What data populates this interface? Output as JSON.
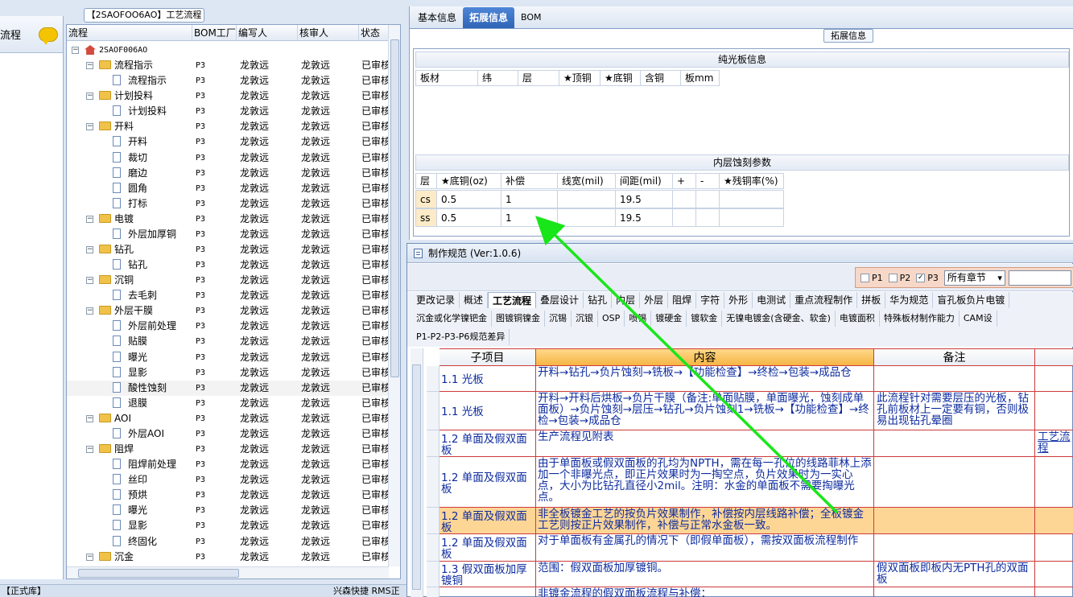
{
  "left_strip": {
    "label": "流程"
  },
  "tree": {
    "title": "【2SAOFOO6AO】工艺流程",
    "columns": [
      "流程",
      "BOM工厂",
      "编写人",
      "核审人",
      "状态"
    ],
    "rows": [
      {
        "level": 0,
        "type": "root",
        "name": "2SAOF006AO",
        "bom": "",
        "writer": "",
        "reviewer": "",
        "status": ""
      },
      {
        "level": 1,
        "type": "folder",
        "name": "流程指示",
        "bom": "P3",
        "writer": "龙敦远",
        "reviewer": "龙敦远",
        "status": "已审核"
      },
      {
        "level": 2,
        "type": "doc",
        "name": "流程指示",
        "bom": "P3",
        "writer": "龙敦远",
        "reviewer": "龙敦远",
        "status": "已审核"
      },
      {
        "level": 1,
        "type": "folder",
        "name": "计划投料",
        "bom": "P3",
        "writer": "龙敦远",
        "reviewer": "龙敦远",
        "status": "已审核"
      },
      {
        "level": 2,
        "type": "doc",
        "name": "计划投料",
        "bom": "P3",
        "writer": "龙敦远",
        "reviewer": "龙敦远",
        "status": "已审核"
      },
      {
        "level": 1,
        "type": "folder",
        "name": "开料",
        "bom": "P3",
        "writer": "龙敦远",
        "reviewer": "龙敦远",
        "status": "已审核"
      },
      {
        "level": 2,
        "type": "doc",
        "name": "开料",
        "bom": "P3",
        "writer": "龙敦远",
        "reviewer": "龙敦远",
        "status": "已审核"
      },
      {
        "level": 2,
        "type": "doc",
        "name": "裁切",
        "bom": "P3",
        "writer": "龙敦远",
        "reviewer": "龙敦远",
        "status": "已审核"
      },
      {
        "level": 2,
        "type": "doc",
        "name": "磨边",
        "bom": "P3",
        "writer": "龙敦远",
        "reviewer": "龙敦远",
        "status": "已审核"
      },
      {
        "level": 2,
        "type": "doc",
        "name": "圆角",
        "bom": "P3",
        "writer": "龙敦远",
        "reviewer": "龙敦远",
        "status": "已审核"
      },
      {
        "level": 2,
        "type": "doc",
        "name": "打标",
        "bom": "P3",
        "writer": "龙敦远",
        "reviewer": "龙敦远",
        "status": "已审核"
      },
      {
        "level": 1,
        "type": "folder",
        "name": "电镀",
        "bom": "P3",
        "writer": "龙敦远",
        "reviewer": "龙敦远",
        "status": "已审核"
      },
      {
        "level": 2,
        "type": "doc",
        "name": "外层加厚铜",
        "bom": "P3",
        "writer": "龙敦远",
        "reviewer": "龙敦远",
        "status": "已审核"
      },
      {
        "level": 1,
        "type": "folder",
        "name": "钻孔",
        "bom": "P3",
        "writer": "龙敦远",
        "reviewer": "龙敦远",
        "status": "已审核"
      },
      {
        "level": 2,
        "type": "doc",
        "name": "钻孔",
        "bom": "P3",
        "writer": "龙敦远",
        "reviewer": "龙敦远",
        "status": "已审核"
      },
      {
        "level": 1,
        "type": "folder",
        "name": "沉铜",
        "bom": "P3",
        "writer": "龙敦远",
        "reviewer": "龙敦远",
        "status": "已审核"
      },
      {
        "level": 2,
        "type": "doc",
        "name": "去毛刺",
        "bom": "P3",
        "writer": "龙敦远",
        "reviewer": "龙敦远",
        "status": "已审核"
      },
      {
        "level": 1,
        "type": "folder",
        "name": "外层干膜",
        "bom": "P3",
        "writer": "龙敦远",
        "reviewer": "龙敦远",
        "status": "已审核"
      },
      {
        "level": 2,
        "type": "doc",
        "name": "外层前处理",
        "bom": "P3",
        "writer": "龙敦远",
        "reviewer": "龙敦远",
        "status": "已审核"
      },
      {
        "level": 2,
        "type": "doc",
        "name": "贴膜",
        "bom": "P3",
        "writer": "龙敦远",
        "reviewer": "龙敦远",
        "status": "已审核"
      },
      {
        "level": 2,
        "type": "doc",
        "name": "曝光",
        "bom": "P3",
        "writer": "龙敦远",
        "reviewer": "龙敦远",
        "status": "已审核"
      },
      {
        "level": 2,
        "type": "doc",
        "name": "显影",
        "bom": "P3",
        "writer": "龙敦远",
        "reviewer": "龙敦远",
        "status": "已审核"
      },
      {
        "level": 2,
        "type": "doc",
        "name": "酸性蚀刻",
        "bom": "P3",
        "writer": "龙敦远",
        "reviewer": "龙敦远",
        "status": "已审核",
        "selected": true
      },
      {
        "level": 2,
        "type": "doc",
        "name": "退膜",
        "bom": "P3",
        "writer": "龙敦远",
        "reviewer": "龙敦远",
        "status": "已审核"
      },
      {
        "level": 1,
        "type": "folder",
        "name": "AOI",
        "bom": "P3",
        "writer": "龙敦远",
        "reviewer": "龙敦远",
        "status": "已审核"
      },
      {
        "level": 2,
        "type": "doc",
        "name": "外层AOI",
        "bom": "P3",
        "writer": "龙敦远",
        "reviewer": "龙敦远",
        "status": "已审核"
      },
      {
        "level": 1,
        "type": "folder",
        "name": "阻焊",
        "bom": "P3",
        "writer": "龙敦远",
        "reviewer": "龙敦远",
        "status": "已审核"
      },
      {
        "level": 2,
        "type": "doc",
        "name": "阻焊前处理",
        "bom": "P3",
        "writer": "龙敦远",
        "reviewer": "龙敦远",
        "status": "已审核"
      },
      {
        "level": 2,
        "type": "doc",
        "name": "丝印",
        "bom": "P3",
        "writer": "龙敦远",
        "reviewer": "龙敦远",
        "status": "已审核"
      },
      {
        "level": 2,
        "type": "doc",
        "name": "预烘",
        "bom": "P3",
        "writer": "龙敦远",
        "reviewer": "龙敦远",
        "status": "已审核"
      },
      {
        "level": 2,
        "type": "doc",
        "name": "曝光",
        "bom": "P3",
        "writer": "龙敦远",
        "reviewer": "龙敦远",
        "status": "已审核"
      },
      {
        "level": 2,
        "type": "doc",
        "name": "显影",
        "bom": "P3",
        "writer": "龙敦远",
        "reviewer": "龙敦远",
        "status": "已审核"
      },
      {
        "level": 2,
        "type": "doc",
        "name": "终固化",
        "bom": "P3",
        "writer": "龙敦远",
        "reviewer": "龙敦远",
        "status": "已审核"
      },
      {
        "level": 1,
        "type": "folder",
        "name": "沉金",
        "bom": "P3",
        "writer": "龙敦远",
        "reviewer": "龙敦远",
        "status": "已审核"
      }
    ]
  },
  "status_bar": {
    "left": "【正式库】",
    "right": "兴森快捷 RMS正"
  },
  "right_tabs": {
    "items": [
      "基本信息",
      "拓展信息",
      "BOM"
    ],
    "active": 1
  },
  "ext": {
    "legend": "拓展信息",
    "section1_title": "纯光板信息",
    "section1_cols": [
      "板材",
      "纬",
      "层",
      "★顶铜",
      "★底铜",
      "含铜",
      "板mm"
    ],
    "section2_title": "内层蚀刻参数",
    "section2_cols": [
      "层",
      "★底铜(oz)",
      "补偿",
      "线宽(mil)",
      "间距(mil)",
      "+",
      "-",
      "★残铜率(%)"
    ],
    "section2_rows": [
      [
        "cs",
        "0.5",
        "1",
        "",
        "19.5",
        "",
        "",
        ""
      ],
      [
        "ss",
        "0.5",
        "1",
        "",
        "19.5",
        "",
        "",
        ""
      ]
    ]
  },
  "popup": {
    "title": "制作规范 (Ver:1.0.6)",
    "filters": [
      {
        "label": "P1",
        "checked": false
      },
      {
        "label": "P2",
        "checked": false
      },
      {
        "label": "P3",
        "checked": true
      }
    ],
    "chapter_select": "所有章节",
    "tabs_row1": [
      "更改记录",
      "概述",
      "工艺流程",
      "叠层设计",
      "钻孔",
      "内层",
      "外层",
      "阻焊",
      "字符",
      "外形",
      "电测试",
      "重点流程制作",
      "拼板",
      "华为规范",
      "盲孔板负片电镀"
    ],
    "tabs_row1_active": 2,
    "tabs_row2": [
      "沉金或化学镍钯金",
      "图镀铜镍金",
      "沉锡",
      "沉银",
      "OSP",
      "喷锡",
      "镀硬金",
      "镀软金",
      "无镍电镀金(含硬金、软金)",
      "电镀面积",
      "特殊板材制作能力",
      "CAM设"
    ],
    "tabs_row3": [
      "P1-P2-P3-P6规范差异"
    ],
    "grid_cols": [
      "子项目",
      "内容",
      "备注"
    ],
    "grid_rows": [
      {
        "sub": "1.1 光板",
        "content": "开料→钻孔→负片蚀刻→铣板→【功能检查】→终检→包装→成品仓",
        "note": "",
        "extra": "",
        "highlight": false
      },
      {
        "sub": "1.1 光板",
        "content": "开料→开料后烘板→负片干膜（备注:单面贴膜，单面曝光，蚀刻成单面板）→负片蚀刻→层压→钻孔→负片蚀刻1→铣板→【功能检查】→终检→包装→成品仓",
        "note": "此流程针对需要层压的光板，钻孔前板材上一定要有铜，否则极易出现钻孔晕圈",
        "extra": "",
        "highlight": false
      },
      {
        "sub": "1.2 单面及假双面板",
        "content": "生产流程见附表",
        "note": "",
        "extra": "工艺流程",
        "highlight": false
      },
      {
        "sub": "1.2 单面及假双面板",
        "content": "由于单面板或假双面板的孔均为NPTH，需在每一孔位的线路菲林上添加一个非曝光点，即正片效果时为一掏空点，负片效果时为一实心点，大小为比钻孔直径小2mil。注明：水金的单面板不需要掏曝光点。",
        "note": "",
        "extra": "",
        "highlight": false
      },
      {
        "sub": "1.2 单面及假双面板",
        "content": "非全板镀金工艺的按负片效果制作，补偿按内层线路补偿；全板镀金工艺则按正片效果制作，补偿与正常水金板一致。",
        "note": "",
        "extra": "",
        "highlight": true
      },
      {
        "sub": "1.2 单面及假双面板",
        "content": "对于单面板有金属孔的情况下（即假单面板），需按双面板流程制作",
        "note": "",
        "extra": "",
        "highlight": false
      },
      {
        "sub": "1.3 假双面板加厚镀铜",
        "content": "范围：假双面板加厚镀铜。",
        "note": "假双面板即板内无PTH孔的双面板",
        "extra": "",
        "highlight": false
      },
      {
        "sub": "",
        "content": "非镀金流程的假双面板流程与补偿：",
        "note": "",
        "extra": "",
        "highlight": false
      }
    ]
  },
  "colors": {
    "accent": "#2f64b6",
    "grid_border": "#cc3b3b",
    "highlight_row": "#fdd696",
    "arrow": "#19e619"
  }
}
